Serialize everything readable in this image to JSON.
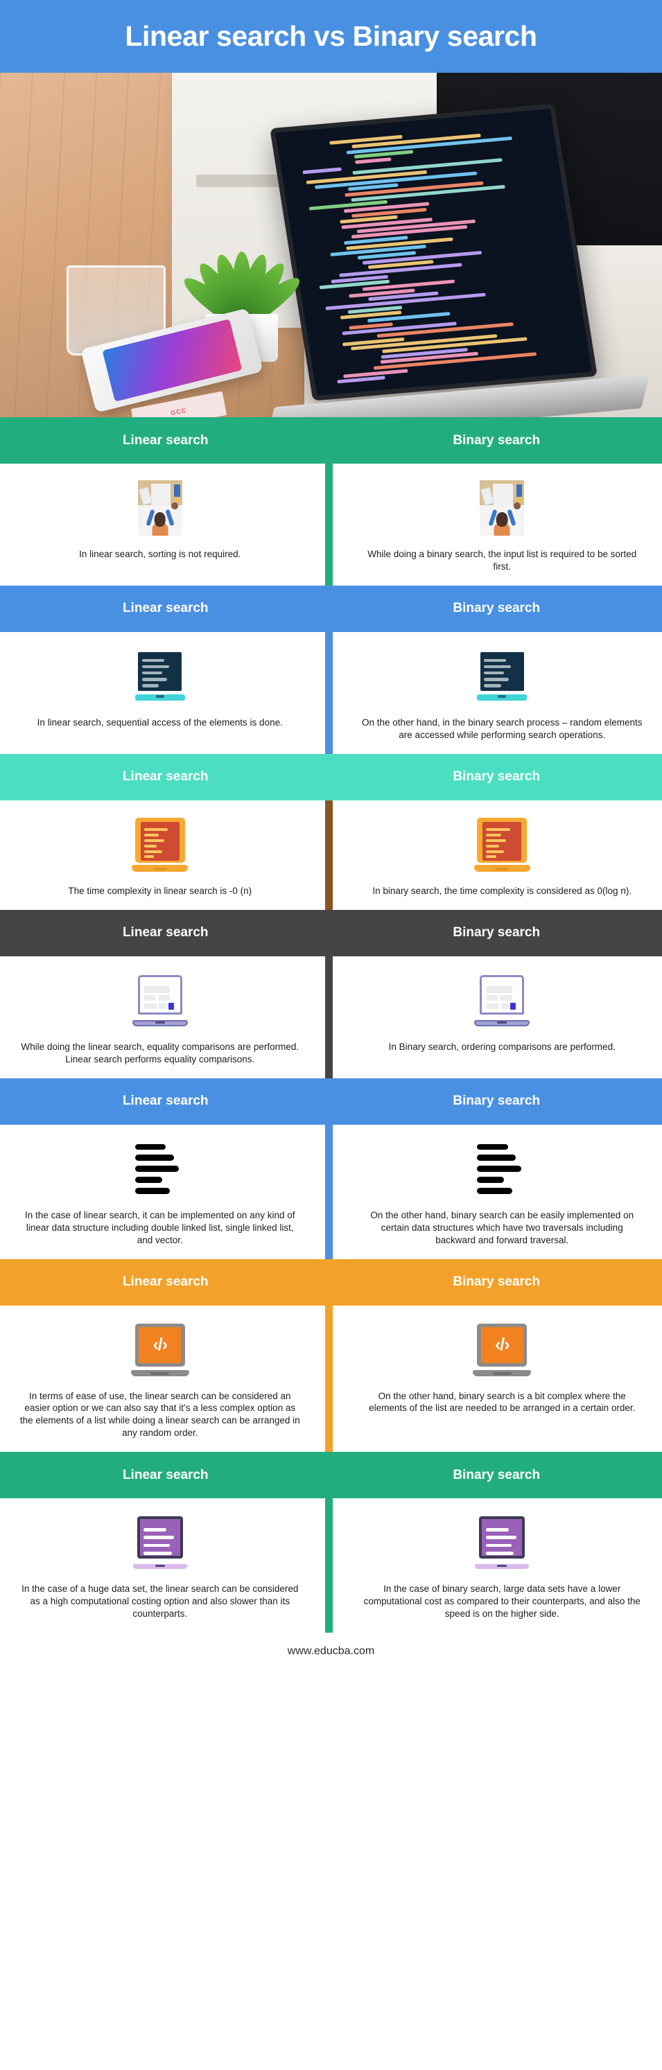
{
  "title": "Linear search vs Binary search",
  "colors": {
    "title_bar": "#4a90e2",
    "green": "#22ad7f",
    "blue": "#4a90e2",
    "mint": "#4cdec2",
    "dark_gray": "#454545",
    "orange": "#f2a22a",
    "brown_divider": "#8a5522"
  },
  "hero": {
    "photo_alt": "laptop-with-code-on-wooden-desk-photo",
    "sticker_text": "GCC"
  },
  "sections": [
    {
      "header_color": "#22ad7f",
      "divider_color": "#22ad7f",
      "icon": "desk-person-icon",
      "left": {
        "heading": "Linear search",
        "text": "In linear search, sorting is not required."
      },
      "right": {
        "heading": "Binary search",
        "text": "While doing a binary search, the input list is required to be sorted first."
      }
    },
    {
      "header_color": "#4a90e2",
      "divider_color": "#4a90e2",
      "icon": "navy-laptop-icon",
      "left": {
        "heading": "Linear search",
        "text": "In linear search, sequential access of the elements is done."
      },
      "right": {
        "heading": "Binary search",
        "text": "On the other hand, in the binary search process – random elements are accessed while performing search operations."
      }
    },
    {
      "header_color": "#4cdec2",
      "divider_color": "#8a5522",
      "icon": "orange-laptop-icon",
      "left": {
        "heading": "Linear search",
        "text": "The time complexity in linear search is -0 (n)"
      },
      "right": {
        "heading": "Binary search",
        "text": "In binary search, the time complexity is considered as 0(log n)."
      }
    },
    {
      "header_color": "#454545",
      "divider_color": "#454545",
      "icon": "purple-laptop-icon",
      "left": {
        "heading": "Linear search",
        "text": "While doing the linear search, equality comparisons are performed. Linear search performs equality comparisons."
      },
      "right": {
        "heading": "Binary search",
        "text": "In Binary search, ordering comparisons are performed."
      }
    },
    {
      "header_color": "#4a90e2",
      "divider_color": "#4a90e2",
      "icon": "black-bars-icon",
      "left": {
        "heading": "Linear search",
        "text": "In the case of linear search, it can be implemented on any kind of linear data structure including double linked list, single linked list, and vector."
      },
      "right": {
        "heading": "Binary search",
        "text": "On the other hand, binary search can be easily implemented on certain data structures which have two traversals including backward and forward traversal."
      }
    },
    {
      "header_color": "#f2a22a",
      "divider_color": "#f2a22a",
      "icon": "code-laptop-icon",
      "icon_glyph": "‹/›",
      "left": {
        "heading": "Linear search",
        "text": "In terms of ease of use, the linear search can be considered an easier option or we can also say that it’s a less complex option as the elements of a list while doing a linear search can be arranged in any random order."
      },
      "right": {
        "heading": "Binary search",
        "text": "On the other hand, binary search is a bit complex where the elements of the list are needed to be arranged in a certain order."
      }
    },
    {
      "header_color": "#22ad7f",
      "divider_color": "#22ad7f",
      "icon": "violet-laptop-icon",
      "left": {
        "heading": "Linear search",
        "text": "In the case of a huge data set, the linear search can be considered as a high computational costing option and also slower than its counterparts."
      },
      "right": {
        "heading": "Binary search",
        "text": "In the case of binary search, large data sets have a lower computational cost as compared to their counterparts, and also the speed is on the higher side."
      }
    }
  ],
  "footer": {
    "url": "www.educba.com"
  }
}
